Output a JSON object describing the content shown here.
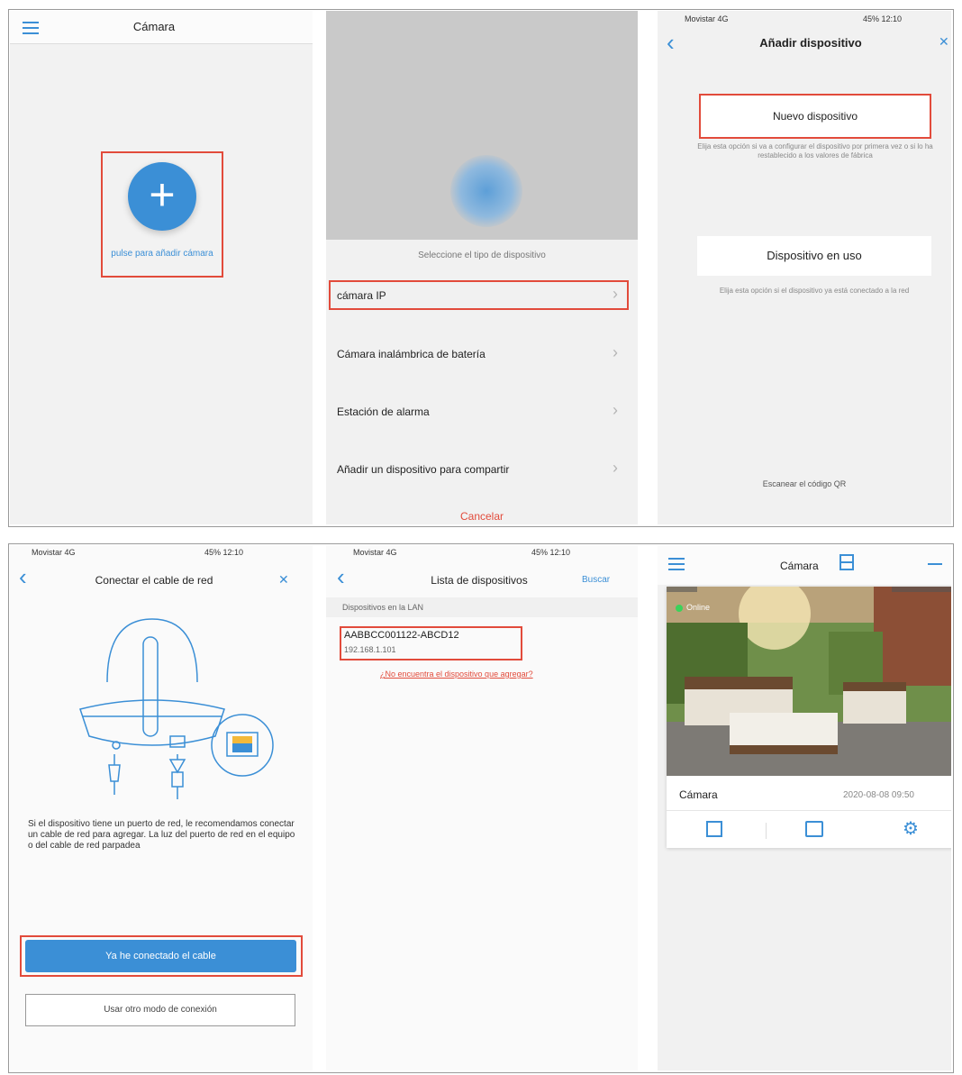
{
  "p1": {
    "title": "Cámara",
    "add_label": "pulse para añadir cámara"
  },
  "p2": {
    "header": "Seleccione el tipo de dispositivo",
    "items": [
      "cámara IP",
      "Cámara inalámbrica de batería",
      "Estación de alarma",
      "Añadir un dispositivo para compartir"
    ],
    "cancel": "Cancelar"
  },
  "p3": {
    "status_left": "Movistar 4G",
    "status_right": "45% 12:10",
    "title": "Añadir dispositivo",
    "new_device": "Nuevo dispositivo",
    "new_device_desc": "Elija esta opción si va a configurar el dispositivo por primera vez o si lo ha restablecido a los valores de fábrica",
    "in_use": "Dispositivo en uso",
    "in_use_desc": "Elija esta opción si el dispositivo ya está conectado a la red",
    "footer": "Escanear el código QR"
  },
  "p4": {
    "status_left": "Movistar 4G",
    "status_right": "45% 12:10",
    "title": "Conectar el cable de red",
    "instructions": "Si el dispositivo tiene un puerto de red, le recomendamos conectar un cable de red para agregar. La luz del puerto de red en el equipo o del cable de red parpadea",
    "primary_button": "Ya he conectado el cable",
    "secondary_button": "Usar otro modo de conexión"
  },
  "p5": {
    "status_left": "Movistar 4G",
    "status_right": "45% 12:10",
    "title": "Lista de dispositivos",
    "refresh": "Buscar",
    "section": "Dispositivos en la LAN",
    "device_name": "AABBCC001122-ABCD12",
    "device_ip": "192.168.1.101",
    "help_link": "¿No encuentra el dispositivo que agregar?"
  },
  "p6": {
    "title": "Cámara",
    "online": "Online",
    "camera_name": "Cámara",
    "camera_info": "2020-08-08 09:50"
  },
  "colors": {
    "accent": "#3b8fd6",
    "highlight": "#e24b3b"
  }
}
